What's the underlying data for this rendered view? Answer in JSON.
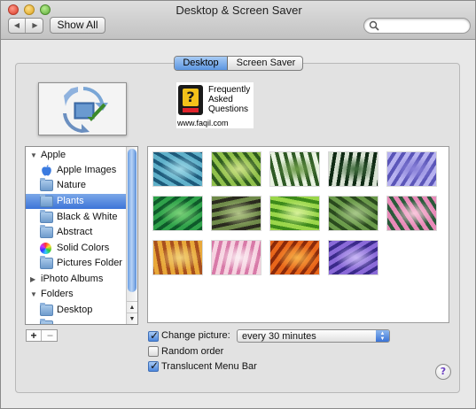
{
  "window": {
    "title": "Desktop & Screen Saver"
  },
  "toolbar": {
    "back_icon": "chevron-left-icon",
    "forward_icon": "chevron-right-icon",
    "show_all_label": "Show All",
    "search_placeholder": "",
    "search_icon": "search-icon"
  },
  "tabs": [
    {
      "label": "Desktop",
      "selected": true
    },
    {
      "label": "Screen Saver",
      "selected": false
    }
  ],
  "faq": {
    "badge_glyph": "?",
    "line1": "Frequently",
    "line2": "Asked",
    "line3": "Questions",
    "url": "www.faqil.com"
  },
  "source_list": {
    "items": [
      {
        "label": "Apple",
        "kind": "group",
        "expanded": true
      },
      {
        "label": "Apple Images",
        "kind": "item",
        "icon": "apple-logo-icon"
      },
      {
        "label": "Nature",
        "kind": "item",
        "icon": "folder-icon"
      },
      {
        "label": "Plants",
        "kind": "item",
        "icon": "folder-icon",
        "selected": true
      },
      {
        "label": "Black & White",
        "kind": "item",
        "icon": "folder-icon"
      },
      {
        "label": "Abstract",
        "kind": "item",
        "icon": "folder-icon"
      },
      {
        "label": "Solid Colors",
        "kind": "item",
        "icon": "color-wheel-icon"
      },
      {
        "label": "Pictures Folder",
        "kind": "item",
        "icon": "folder-icon"
      },
      {
        "label": "iPhoto Albums",
        "kind": "group",
        "expanded": false
      },
      {
        "label": "Folders",
        "kind": "group",
        "expanded": true
      },
      {
        "label": "Desktop",
        "kind": "item",
        "icon": "folder-icon"
      }
    ],
    "add_label": "+",
    "remove_label": "−"
  },
  "thumbnails": [
    {
      "name": "blue-agave",
      "colors": [
        "#1d5a7a",
        "#5fb0c9",
        "#9fd9e8"
      ]
    },
    {
      "name": "bamboo",
      "colors": [
        "#2e5a1e",
        "#8fbf4a",
        "#cfe38a"
      ]
    },
    {
      "name": "white-flowers",
      "colors": [
        "#2f5a25",
        "#e8f2e0",
        "#6a9a45"
      ]
    },
    {
      "name": "dandelion",
      "colors": [
        "#0f2a14",
        "#d8e2d3",
        "#3d6a3a"
      ]
    },
    {
      "name": "lavender-petals",
      "colors": [
        "#5a55b8",
        "#b7b2f0",
        "#8a82d9"
      ]
    },
    {
      "name": "grass-blades",
      "colors": [
        "#0e5a2a",
        "#2fa24a",
        "#7cd37a"
      ]
    },
    {
      "name": "sprouts",
      "colors": [
        "#2a2a1e",
        "#6f8a4a",
        "#b5c88a"
      ]
    },
    {
      "name": "green-spiral",
      "colors": [
        "#3d8a1a",
        "#9ad64a",
        "#d8f29a"
      ]
    },
    {
      "name": "moss",
      "colors": [
        "#2a4a1e",
        "#6a9a4a",
        "#a8c88a"
      ]
    },
    {
      "name": "lotus",
      "colors": [
        "#2a5a3a",
        "#e88ab8",
        "#f8c8dc"
      ]
    },
    {
      "name": "autumn-leaves",
      "colors": [
        "#a8501e",
        "#e8a83a",
        "#f2d27a"
      ]
    },
    {
      "name": "pink-blossom",
      "colors": [
        "#d87aa8",
        "#f6d2e0",
        "#fbeef3"
      ]
    },
    {
      "name": "orange-rose",
      "colors": [
        "#8a2a0a",
        "#e8661a",
        "#f8b24a"
      ]
    },
    {
      "name": "purple-flower",
      "colors": [
        "#3a2a8a",
        "#8a6ad8",
        "#c9b8f5"
      ]
    }
  ],
  "options": {
    "change_picture": {
      "label": "Change picture:",
      "checked": true
    },
    "interval": {
      "value": "every 30 minutes"
    },
    "random_order": {
      "label": "Random order",
      "checked": false
    },
    "translucent_menu_bar": {
      "label": "Translucent Menu Bar",
      "checked": true
    },
    "help_glyph": "?"
  }
}
